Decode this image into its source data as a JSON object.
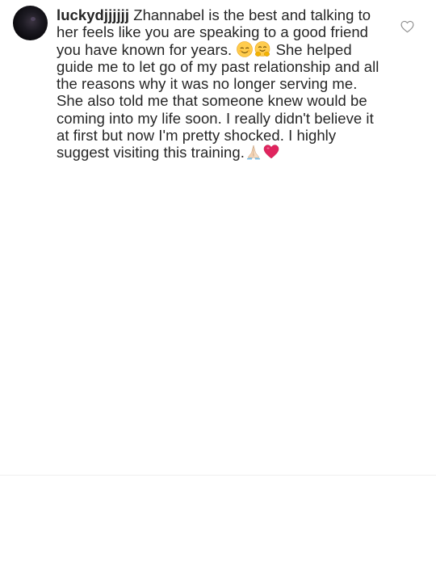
{
  "comment": {
    "username": "luckydjjjjjj",
    "line1_part1": " Zhannabel is the best and talking to her feels like you are speaking to a good friend you have known for years. ",
    "line1_part2": " She helped guide me to let go of my past relationship and all the reasons why it was no longer serving me.",
    "line2": "She also told me that someone knew would be coming into my life soon. I really didn't believe it at first but now I'm pretty shocked. I highly suggest visiting this training.",
    "emojis": [
      "relieved-face-emoji",
      "hugging-face-emoji",
      "folded-hands-emoji",
      "red-heart-emoji"
    ],
    "liked": false
  },
  "colors": {
    "text": "#262626",
    "divider": "#efefef",
    "heart_outline": "#8e8e8e",
    "heart_emoji": "#e0245e",
    "emoji_face": "#ffcc4d"
  }
}
